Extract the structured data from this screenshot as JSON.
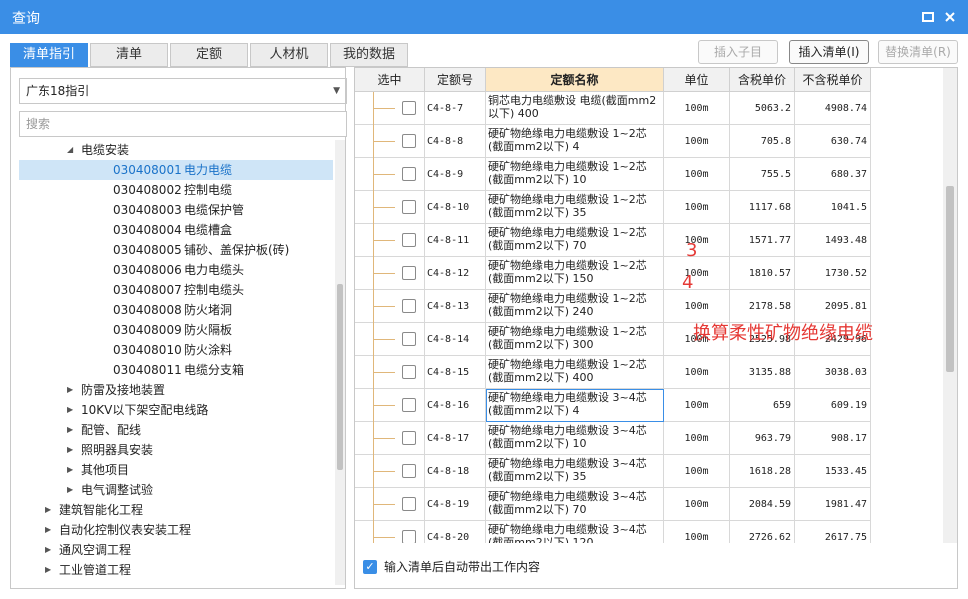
{
  "window": {
    "title": "查询"
  },
  "tabs": [
    {
      "label": "清单指引",
      "active": true
    },
    {
      "label": "清单",
      "active": false
    },
    {
      "label": "定额",
      "active": false
    },
    {
      "label": "人材机",
      "active": false
    },
    {
      "label": "我的数据",
      "active": false
    }
  ],
  "toolbar": {
    "insert_child": "插入子目",
    "insert_list": "插入清单(I)",
    "replace_list": "替换清单(R)"
  },
  "left": {
    "select_value": "广东18指引",
    "search_placeholder": "搜索",
    "tree": [
      {
        "label": "电缆安装",
        "level": 2,
        "expanded": true
      },
      {
        "code": "030408001",
        "label": "电力电缆",
        "level": 3,
        "selected": true
      },
      {
        "code": "030408002",
        "label": "控制电缆",
        "level": 3
      },
      {
        "code": "030408003",
        "label": "电缆保护管",
        "level": 3
      },
      {
        "code": "030408004",
        "label": "电缆槽盒",
        "level": 3
      },
      {
        "code": "030408005",
        "label": "铺砂、盖保护板(砖)",
        "level": 3
      },
      {
        "code": "030408006",
        "label": "电力电缆头",
        "level": 3
      },
      {
        "code": "030408007",
        "label": "控制电缆头",
        "level": 3
      },
      {
        "code": "030408008",
        "label": "防火堵洞",
        "level": 3
      },
      {
        "code": "030408009",
        "label": "防火隔板",
        "level": 3
      },
      {
        "code": "030408010",
        "label": "防火涂料",
        "level": 3
      },
      {
        "code": "030408011",
        "label": "电缆分支箱",
        "level": 3
      },
      {
        "label": "防雷及接地装置",
        "level": 2
      },
      {
        "label": "10KV以下架空配电线路",
        "level": 2
      },
      {
        "label": "配管、配线",
        "level": 2
      },
      {
        "label": "照明器具安装",
        "level": 2
      },
      {
        "label": "其他项目",
        "level": 2
      },
      {
        "label": "电气调整试验",
        "level": 2
      },
      {
        "label": "建筑智能化工程",
        "level": 1
      },
      {
        "label": "自动化控制仪表安装工程",
        "level": 1
      },
      {
        "label": "通风空调工程",
        "level": 1
      },
      {
        "label": "工业管道工程",
        "level": 1
      }
    ]
  },
  "grid": {
    "headers": [
      "选中",
      "定额号",
      "定额名称",
      "单位",
      "含税单价",
      "不含税单价"
    ],
    "rows": [
      {
        "code": "C4-8-7",
        "name1": "铜芯电力电缆敷设 电缆(截面mm2",
        "name2": "以下) 400",
        "unit": "100m",
        "tax": "5063.2",
        "notax": "4908.74"
      },
      {
        "code": "C4-8-8",
        "name1": "硬矿物绝缘电力电缆敷设 1~2芯",
        "name2": "(截面mm2以下) 4",
        "unit": "100m",
        "tax": "705.8",
        "notax": "630.74"
      },
      {
        "code": "C4-8-9",
        "name1": "硬矿物绝缘电力电缆敷设 1~2芯",
        "name2": "(截面mm2以下) 10",
        "unit": "100m",
        "tax": "755.5",
        "notax": "680.37"
      },
      {
        "code": "C4-8-10",
        "name1": "硬矿物绝缘电力电缆敷设 1~2芯",
        "name2": "(截面mm2以下) 35",
        "unit": "100m",
        "tax": "1117.68",
        "notax": "1041.5"
      },
      {
        "code": "C4-8-11",
        "name1": "硬矿物绝缘电力电缆敷设 1~2芯",
        "name2": "(截面mm2以下) 70",
        "unit": "100m",
        "tax": "1571.77",
        "notax": "1493.48"
      },
      {
        "code": "C4-8-12",
        "name1": "硬矿物绝缘电力电缆敷设 1~2芯",
        "name2": "(截面mm2以下) 150",
        "unit": "100m",
        "tax": "1810.57",
        "notax": "1730.52"
      },
      {
        "code": "C4-8-13",
        "name1": "硬矿物绝缘电力电缆敷设 1~2芯",
        "name2": "(截面mm2以下) 240",
        "unit": "100m",
        "tax": "2178.58",
        "notax": "2095.81"
      },
      {
        "code": "C4-8-14",
        "name1": "硬矿物绝缘电力电缆敷设 1~2芯",
        "name2": "(截面mm2以下) 300",
        "unit": "100m",
        "tax": "2525.98",
        "notax": "2429.96"
      },
      {
        "code": "C4-8-15",
        "name1": "硬矿物绝缘电力电缆敷设 1~2芯",
        "name2": "(截面mm2以下) 400",
        "unit": "100m",
        "tax": "3135.88",
        "notax": "3038.03"
      },
      {
        "code": "C4-8-16",
        "name1": "硬矿物绝缘电力电缆敷设 3~4芯",
        "name2": "(截面mm2以下) 4",
        "unit": "100m",
        "tax": "659",
        "notax": "609.19",
        "focus": true
      },
      {
        "code": "C4-8-17",
        "name1": "硬矿物绝缘电力电缆敷设 3~4芯",
        "name2": "(截面mm2以下) 10",
        "unit": "100m",
        "tax": "963.79",
        "notax": "908.17"
      },
      {
        "code": "C4-8-18",
        "name1": "硬矿物绝缘电力电缆敷设 3~4芯",
        "name2": "(截面mm2以下) 35",
        "unit": "100m",
        "tax": "1618.28",
        "notax": "1533.45"
      },
      {
        "code": "C4-8-19",
        "name1": "硬矿物绝缘电力电缆敷设 3~4芯",
        "name2": "(截面mm2以下) 70",
        "unit": "100m",
        "tax": "2084.59",
        "notax": "1981.47"
      },
      {
        "code": "C4-8-20",
        "name1": "硬矿物绝缘电力电缆敷设 3~4芯",
        "name2": "(截面mm2以下) 120",
        "unit": "100m",
        "tax": "2726.62",
        "notax": "2617.75"
      }
    ]
  },
  "annotations": {
    "a3": "3",
    "a4": "4",
    "note": "换算柔性矿物绝缘电缆",
    "color": "#e53935"
  },
  "bottom": {
    "auto_content_label": "输入清单后自动带出工作内容",
    "checked": true
  },
  "colors": {
    "accent": "#3a8ee6",
    "selected_row": "#cfe5f7",
    "header_highlight": "#fde8c4"
  }
}
